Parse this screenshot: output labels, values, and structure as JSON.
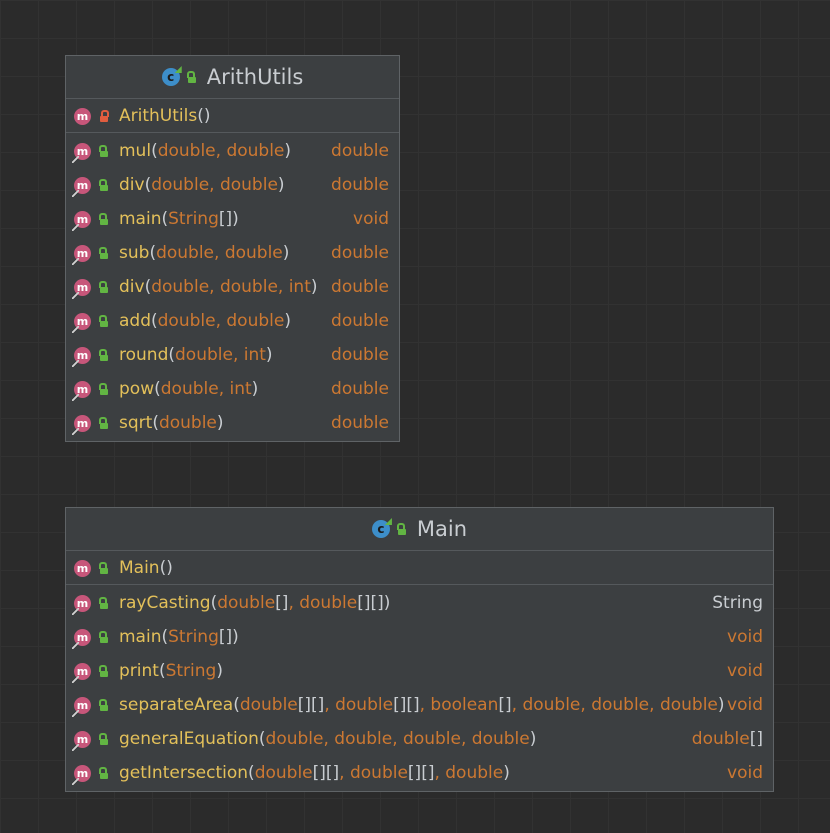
{
  "classes": [
    {
      "name": "ArithUtils",
      "constructor": {
        "name": "ArithUtils",
        "open": "(",
        "params": "",
        "close": ")",
        "visibility": "private"
      },
      "methods": [
        {
          "name": "mul",
          "open": "(",
          "params": "double, double",
          "close": ")",
          "returns": "double"
        },
        {
          "name": "div",
          "open": "(",
          "params": "double, double",
          "close": ")",
          "returns": "double"
        },
        {
          "name": "main",
          "open": "(",
          "params": "String[]",
          "close": ")",
          "returns": "void"
        },
        {
          "name": "sub",
          "open": "(",
          "params": "double, double",
          "close": ")",
          "returns": "double"
        },
        {
          "name": "div",
          "open": "(",
          "params": "double, double, int",
          "close": ")",
          "returns": "double"
        },
        {
          "name": "add",
          "open": "(",
          "params": "double, double",
          "close": ")",
          "returns": "double"
        },
        {
          "name": "round",
          "open": "(",
          "params": "double, int",
          "close": ")",
          "returns": "double"
        },
        {
          "name": "pow",
          "open": "(",
          "params": "double, int",
          "close": ")",
          "returns": "double"
        },
        {
          "name": "sqrt",
          "open": "(",
          "params": "double",
          "close": ")",
          "returns": "double"
        }
      ]
    },
    {
      "name": "Main",
      "constructor": {
        "name": "Main",
        "open": "(",
        "params": "",
        "close": ")",
        "visibility": "public"
      },
      "methods": [
        {
          "name": "rayCasting",
          "open": "(",
          "params": "double[], double[][]",
          "close": ")",
          "returns": "String"
        },
        {
          "name": "main",
          "open": "(",
          "params": "String[]",
          "close": ")",
          "returns": "void"
        },
        {
          "name": "print",
          "open": "(",
          "params": "String",
          "close": ")",
          "returns": "void"
        },
        {
          "name": "separateArea",
          "open": "(",
          "params": "double[][], double[][], boolean[], double, double, double",
          "close": ")",
          "returns": "void"
        },
        {
          "name": "generalEquation",
          "open": "(",
          "params": "double, double, double, double",
          "close": ")",
          "returns": "double[]"
        },
        {
          "name": "getIntersection",
          "open": "(",
          "params": "double[][], double[][], double",
          "close": ")",
          "returns": "void"
        }
      ]
    }
  ],
  "icons": {
    "class": "class-icon",
    "method": "method-icon",
    "public": "unlocked-icon",
    "private": "lock-icon",
    "static": "static-marker-icon"
  },
  "colors": {
    "background": "#2b2b2b",
    "box": "#3c3f41",
    "method_name": "#e3c05a",
    "param_type": "#cc7832",
    "class_icon": "#3d8ec9",
    "method_icon": "#c7567a",
    "public": "#62b543",
    "private": "#e05d3f"
  }
}
